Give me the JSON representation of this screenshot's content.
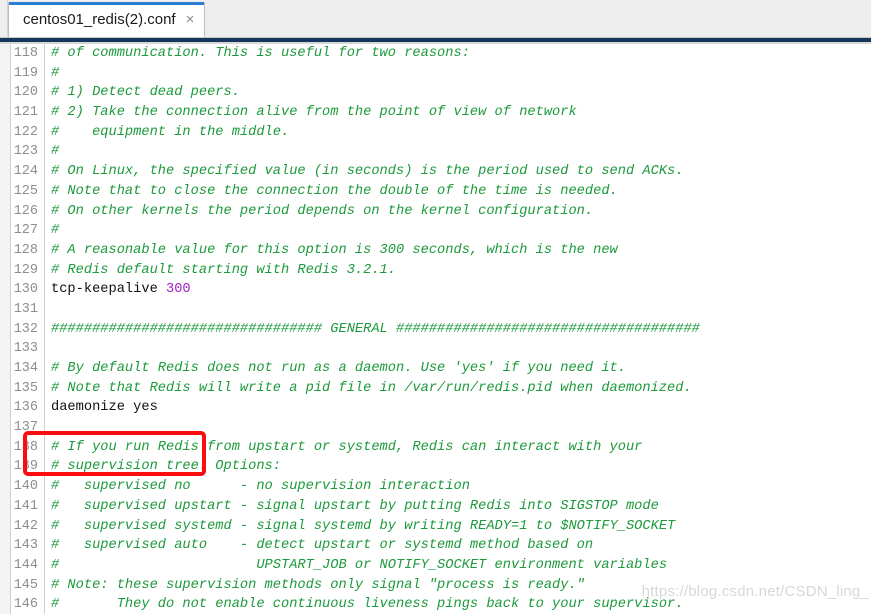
{
  "window": {
    "tab": {
      "label": "centos01_redis(2).conf",
      "close_label": "×",
      "accent_color": "#2a7fd4"
    }
  },
  "editor": {
    "gutter_color": "#8e8e8e",
    "comment_color": "#1d9a3c",
    "plain_color": "#111111",
    "number_color": "#a020c0",
    "first_line": 118,
    "lines": [
      {
        "no": "118",
        "kind": "comment",
        "text": "# of communication. This is useful for two reasons:"
      },
      {
        "no": "119",
        "kind": "comment",
        "text": "#"
      },
      {
        "no": "120",
        "kind": "comment",
        "text": "# 1) Detect dead peers."
      },
      {
        "no": "121",
        "kind": "comment",
        "text": "# 2) Take the connection alive from the point of view of network"
      },
      {
        "no": "122",
        "kind": "comment",
        "text": "#    equipment in the middle."
      },
      {
        "no": "123",
        "kind": "comment",
        "text": "#"
      },
      {
        "no": "124",
        "kind": "comment",
        "text": "# On Linux, the specified value (in seconds) is the period used to send ACKs."
      },
      {
        "no": "125",
        "kind": "comment",
        "text": "# Note that to close the connection the double of the time is needed."
      },
      {
        "no": "126",
        "kind": "comment",
        "text": "# On other kernels the period depends on the kernel configuration."
      },
      {
        "no": "127",
        "kind": "comment",
        "text": "#"
      },
      {
        "no": "128",
        "kind": "comment",
        "text": "# A reasonable value for this option is 300 seconds, which is the new"
      },
      {
        "no": "129",
        "kind": "comment",
        "text": "# Redis default starting with Redis 3.2.1."
      },
      {
        "no": "130",
        "kind": "directive",
        "text": "tcp-keepalive ",
        "value": "300"
      },
      {
        "no": "131",
        "kind": "comment",
        "text": ""
      },
      {
        "no": "132",
        "kind": "comment",
        "text": "################################# GENERAL #####################################"
      },
      {
        "no": "133",
        "kind": "comment",
        "text": ""
      },
      {
        "no": "134",
        "kind": "comment",
        "text": "# By default Redis does not run as a daemon. Use 'yes' if you need it."
      },
      {
        "no": "135",
        "kind": "comment",
        "text": "# Note that Redis will write a pid file in /var/run/redis.pid when daemonized."
      },
      {
        "no": "136",
        "kind": "plain",
        "text": "daemonize yes"
      },
      {
        "no": "137",
        "kind": "comment",
        "text": ""
      },
      {
        "no": "138",
        "kind": "comment",
        "text": "# If you run Redis from upstart or systemd, Redis can interact with your"
      },
      {
        "no": "139",
        "kind": "comment",
        "text": "# supervision tree. Options:"
      },
      {
        "no": "140",
        "kind": "comment",
        "text": "#   supervised no      - no supervision interaction"
      },
      {
        "no": "141",
        "kind": "comment",
        "text": "#   supervised upstart - signal upstart by putting Redis into SIGSTOP mode"
      },
      {
        "no": "142",
        "kind": "comment",
        "text": "#   supervised systemd - signal systemd by writing READY=1 to $NOTIFY_SOCKET"
      },
      {
        "no": "143",
        "kind": "comment",
        "text": "#   supervised auto    - detect upstart or systemd method based on"
      },
      {
        "no": "144",
        "kind": "comment",
        "text": "#                        UPSTART_JOB or NOTIFY_SOCKET environment variables"
      },
      {
        "no": "145",
        "kind": "comment",
        "text": "# Note: these supervision methods only signal \"process is ready.\""
      },
      {
        "no": "146",
        "kind": "comment",
        "text": "#       They do not enable continuous liveness pings back to your supervisor."
      }
    ]
  },
  "annotation": {
    "type": "rectangle-highlight",
    "color": "#fb0d0d",
    "target_line": "136",
    "target_text": "daemonize yes"
  },
  "watermark": {
    "text": "https://blog.csdn.net/CSDN_ling_",
    "color": "#d8d8d8"
  }
}
